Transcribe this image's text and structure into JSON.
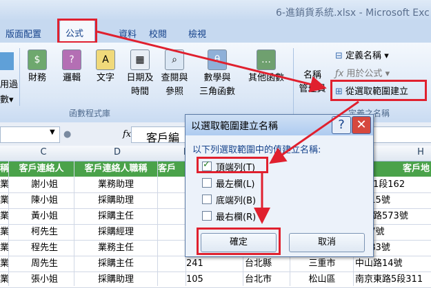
{
  "window_title": "6-進銷貨系統.xlsx - Microsoft Exc",
  "tabs": [
    "版面配置",
    "公式",
    "資料",
    "校閱",
    "檢視"
  ],
  "ribbon": {
    "left_partial": [
      "用過",
      "數▾"
    ],
    "buttons": [
      {
        "icon": "財務",
        "label1": "財務",
        "label2": ""
      },
      {
        "icon": "?",
        "label1": "邏輯",
        "label2": ""
      },
      {
        "icon": "A",
        "label1": "文字",
        "label2": ""
      },
      {
        "icon": "日",
        "label1": "日期及",
        "label2": "時間"
      },
      {
        "icon": "查",
        "label1": "查閱與",
        "label2": "參照"
      },
      {
        "icon": "θ",
        "label1": "數學與",
        "label2": "三角函數"
      },
      {
        "icon": "…",
        "label1": "其他函數",
        "label2": ""
      }
    ],
    "group_library": "函數程式庫",
    "name_manager": [
      "名稱",
      "管理員"
    ],
    "define_name": "定義名稱",
    "use_in_formula": "用於公式",
    "create_from_selection": "從選取範圍建立",
    "group_defined": "定義之名稱"
  },
  "formula_bar": {
    "fx": "fx",
    "content": "客戶編"
  },
  "columns": [
    "C",
    "D",
    "E",
    "H"
  ],
  "headers": [
    "稱",
    "客戶連絡人",
    "客戶連絡人職稱",
    "客戶",
    "客戶地"
  ],
  "rows": [
    {
      "b": "業",
      "c": "謝小姐",
      "d": "業務助理",
      "e": "",
      "f": "",
      "g": "",
      "h": "南路1段162"
    },
    {
      "b": "業",
      "c": "陳小姐",
      "d": "採購助理",
      "e": "",
      "f": "",
      "g": "",
      "h": "路115號"
    },
    {
      "b": "業",
      "c": "黃小姐",
      "d": "採購主任",
      "e": "",
      "f": "",
      "g": "",
      "h": "南北路573號"
    },
    {
      "b": "業",
      "c": "柯先生",
      "d": "採購經理",
      "e": "",
      "f": "",
      "g": "",
      "h": "路17號"
    },
    {
      "b": "業",
      "c": "程先生",
      "d": "業務主任",
      "e": "",
      "f": "",
      "g": "",
      "h": "路183號"
    },
    {
      "b": "業",
      "c": "周先生",
      "d": "採購主任",
      "e": "241",
      "f": "台北縣",
      "g": "三重市",
      "h": "中山路14號"
    },
    {
      "b": "業",
      "c": "張小姐",
      "d": "採購助理",
      "e": "105",
      "f": "台北市",
      "g": "松山區",
      "h": "南京東路5段311"
    }
  ],
  "dialog": {
    "title": "以選取範圍建立名稱",
    "prompt": "以下列選取範圍中的值建立名稱:",
    "options": [
      {
        "label": "頂端列(T)",
        "checked": true
      },
      {
        "label": "最左欄(L)",
        "checked": false
      },
      {
        "label": "底端列(B)",
        "checked": false
      },
      {
        "label": "最右欄(R)",
        "checked": false
      }
    ],
    "ok": "確定",
    "cancel": "取消",
    "help": "?",
    "close": "✕"
  }
}
